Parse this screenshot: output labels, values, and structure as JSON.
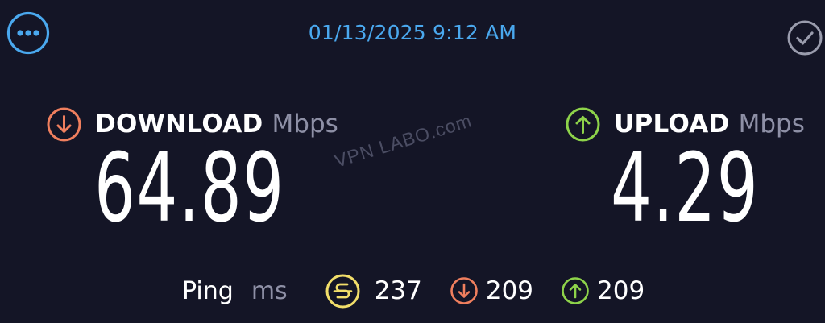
{
  "header": {
    "timestamp": "01/13/2025 9:12 AM",
    "menu_icon": "more-dots-icon",
    "status_icon": "check-circle-icon"
  },
  "download": {
    "label": "DOWNLOAD",
    "unit": "Mbps",
    "value": "64.89",
    "icon": "arrow-down-circle-icon"
  },
  "upload": {
    "label": "UPLOAD",
    "unit": "Mbps",
    "value": "4.29",
    "icon": "arrow-up-circle-icon"
  },
  "ping": {
    "label": "Ping",
    "unit": "ms",
    "idle": "237",
    "download": "209",
    "upload": "209"
  },
  "watermark": "VPN LABO.com",
  "colors": {
    "background": "#141526",
    "accent_blue": "#4aa8ee",
    "download_orange": "#f07f5e",
    "upload_green": "#8ed34a",
    "idle_yellow": "#f2de6a",
    "muted": "#8e90a6"
  }
}
